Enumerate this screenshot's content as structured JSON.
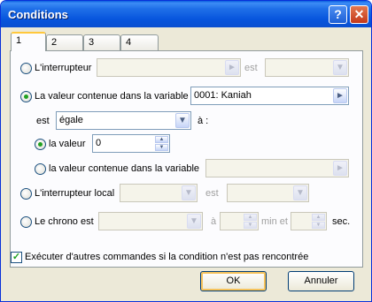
{
  "window": {
    "title": "Conditions",
    "help_label": "?",
    "close_label": "✕"
  },
  "tabs": [
    "1",
    "2",
    "3",
    "4"
  ],
  "switch": {
    "label": "L'interrupteur",
    "value": "",
    "is_label": "est",
    "state": ""
  },
  "variable": {
    "label": "La valeur contenue dans la variable",
    "value": "0001: Kaniah",
    "is_label": "est",
    "operator": "égale",
    "operator_suffix": "à :"
  },
  "compare_value": {
    "label": "la valeur",
    "value": "0"
  },
  "compare_variable": {
    "label": "la valeur contenue dans la variable",
    "value": ""
  },
  "local_switch": {
    "label": "L'interrupteur local",
    "letter": "",
    "is_label": "est",
    "state": ""
  },
  "timer": {
    "label": "Le chrono est",
    "op": "",
    "at_label": "à",
    "minutes": "",
    "min_label": "min et",
    "seconds": "",
    "sec_label": "sec."
  },
  "else_branch": {
    "label": "Exécuter d'autres commandes si la condition n'est pas rencontrée",
    "checked": true
  },
  "buttons": {
    "ok": "OK",
    "cancel": "Annuler"
  },
  "icons": {
    "combo_arrow": "chevron-down-icon",
    "picker_arrow": "chevron-right-icon"
  }
}
